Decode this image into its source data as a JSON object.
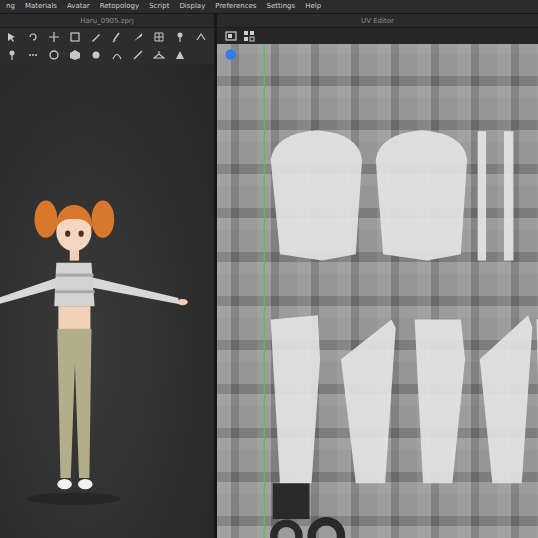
{
  "menu": {
    "items": [
      "ng",
      "Materials",
      "Avatar",
      "Retopology",
      "Script",
      "Display",
      "Preferences",
      "Settings",
      "Help"
    ]
  },
  "viewport": {
    "title": "Haru_0905.zprj"
  },
  "uv_editor": {
    "title": "UV Editor"
  }
}
